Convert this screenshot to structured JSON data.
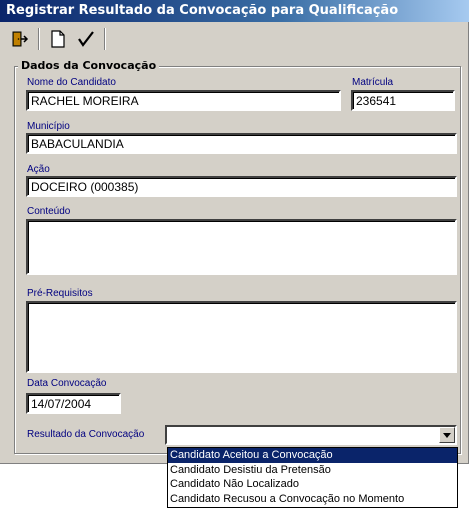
{
  "window": {
    "title": "Registrar Resultado da Convocação para Qualificação"
  },
  "toolbar": {
    "exit_icon": "exit-door-icon",
    "new_icon": "new-document-icon",
    "confirm_icon": "checkmark-icon"
  },
  "group": {
    "legend": "Dados da Convocação"
  },
  "form": {
    "nome_label": "Nome do Candidato",
    "nome_value": "RACHEL MOREIRA",
    "matricula_label": "Matrícula",
    "matricula_value": "236541",
    "municipio_label": "Município",
    "municipio_value": "BABACULANDIA",
    "acao_label": "Ação",
    "acao_value": "DOCEIRO (000385)",
    "conteudo_label": "Conteúdo",
    "conteudo_value": "",
    "prereq_label": "Pré-Requisitos",
    "prereq_value": "",
    "data_label": "Data Convocação",
    "data_value": "14/07/2004",
    "resultado_label": "Resultado da Convocação",
    "resultado_value": ""
  },
  "dropdown": {
    "options": [
      "Candidato Aceitou a Convocação",
      "Candidato Desistiu da Pretensão",
      "Candidato Não Localizado",
      "Candidato Recusou a Convocação no Momento"
    ],
    "highlighted_index": 0
  }
}
